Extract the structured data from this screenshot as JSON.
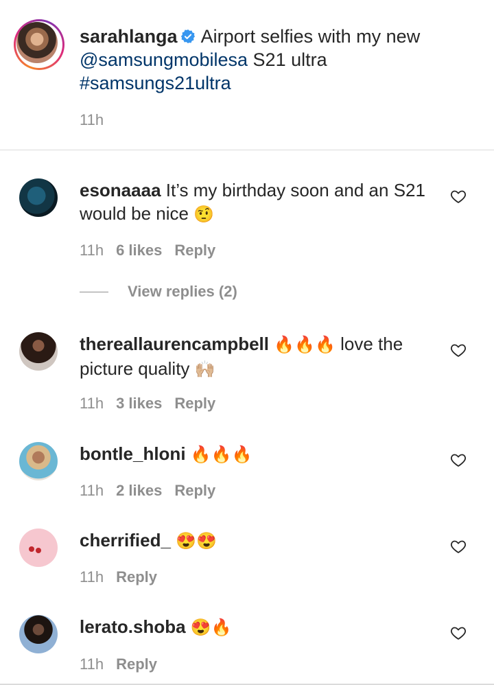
{
  "post": {
    "username": "sarahlanga",
    "caption": "Airport selfies with my new",
    "mention": "@samsungmobilesa",
    "caption_end": "S21 ultra",
    "hashtag": "#samsungs21ultra",
    "time": "11h"
  },
  "comments": [
    {
      "username": "esonaaaa",
      "text": "It’s my birthday soon and an S21 would be nice",
      "emoji": "🤨",
      "time": "11h",
      "likes": "6 likes",
      "reply": "Reply",
      "view_replies": "View replies (2)"
    },
    {
      "username": "thereallaurencampbell",
      "emoji_before": "🔥🔥🔥",
      "text": "love the picture quality",
      "emoji": "🙌🏼",
      "time": "11h",
      "likes": "3 likes",
      "reply": "Reply"
    },
    {
      "username": "bontle_hloni",
      "emoji": "🔥🔥🔥",
      "time": "11h",
      "likes": "2 likes",
      "reply": "Reply"
    },
    {
      "username": "cherrified_",
      "emoji": "😍😍",
      "time": "11h",
      "reply": "Reply"
    },
    {
      "username": "lerato.shoba",
      "emoji": "😍🔥",
      "time": "11h",
      "reply": "Reply"
    }
  ],
  "colors": {
    "link": "#003569",
    "meta": "#8e8e8e",
    "verified": "#3897f0"
  }
}
